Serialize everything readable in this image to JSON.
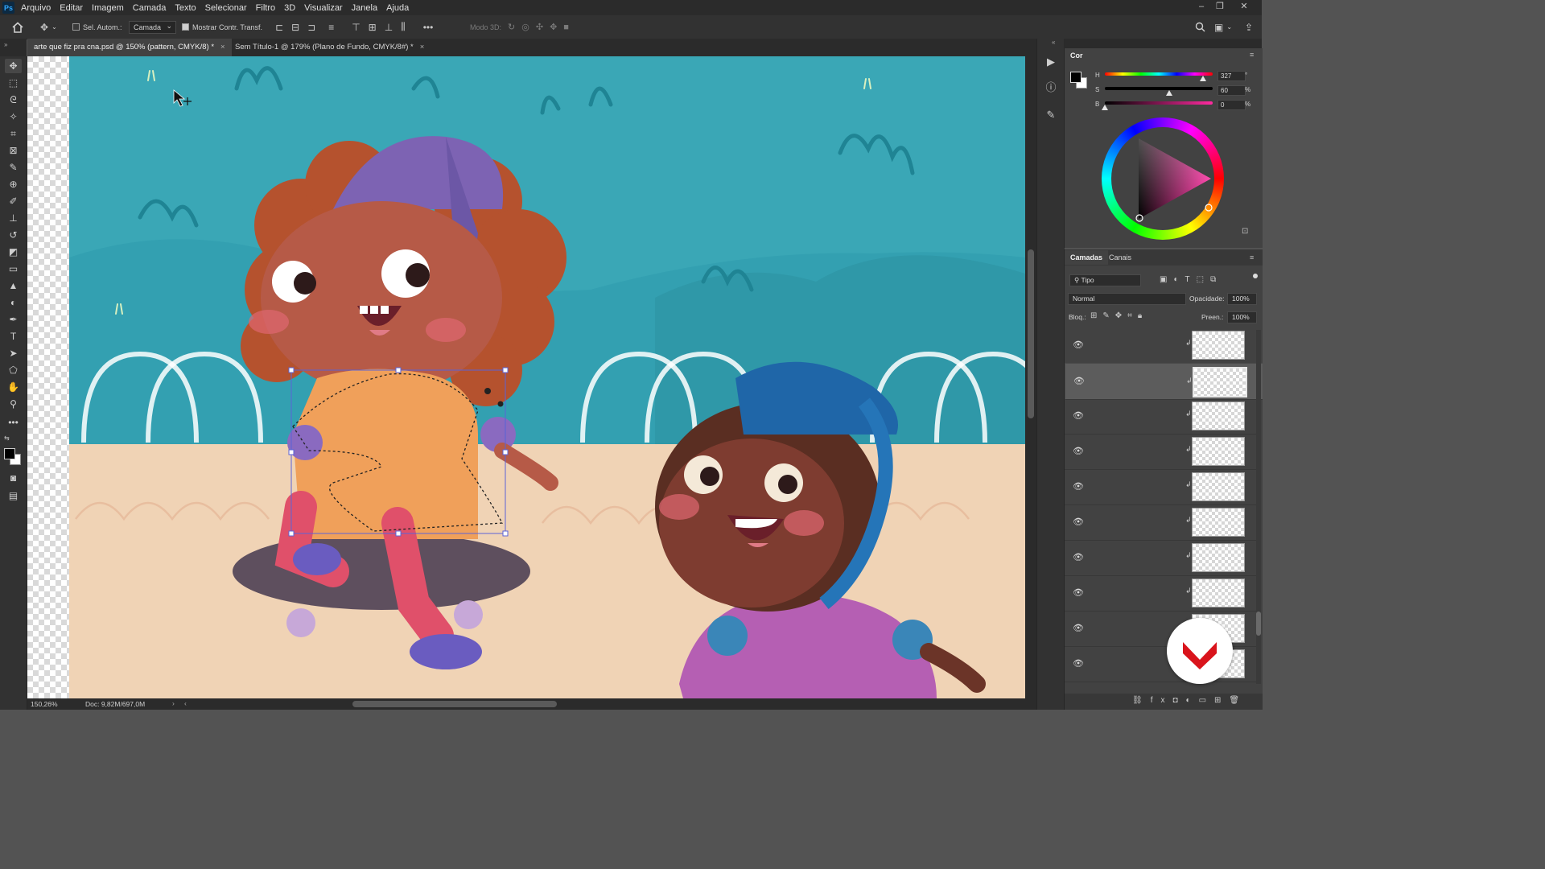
{
  "app": {
    "name": "Photoshop",
    "logo_text": "Ps"
  },
  "menu": [
    "Arquivo",
    "Editar",
    "Imagem",
    "Camada",
    "Texto",
    "Selecionar",
    "Filtro",
    "3D",
    "Visualizar",
    "Janela",
    "Ajuda"
  ],
  "options_bar": {
    "auto_select_label": "Sel. Autom.:",
    "auto_select_target": "Camada",
    "show_transform_label": "Mostrar Contr. Transf.",
    "mode_3d_label": "Modo 3D:"
  },
  "tabs": [
    {
      "label": "arte que fiz pra cna.psd @ 150% (pattern, CMYK/8) *",
      "active": true
    },
    {
      "label": "Sem Título-1 @ 179% (Plano de Fundo, CMYK/8#) *",
      "active": false
    }
  ],
  "status": {
    "zoom": "150,26%",
    "doc": "Doc: 9,82M/697,0M"
  },
  "color_panel": {
    "tab": "Cor",
    "sliders": [
      {
        "label": "H",
        "value": "327",
        "unit": "°",
        "level": 0.91
      },
      {
        "label": "S",
        "value": "60",
        "unit": "%",
        "level": 0.6
      },
      {
        "label": "B",
        "value": "0",
        "unit": "%",
        "level": 0.0
      }
    ],
    "hue_color": "#ff2aa0",
    "fg_color": "#000000",
    "bg_color": "#ffffff"
  },
  "layers_panel": {
    "tabs": [
      "Camadas",
      "Canais"
    ],
    "filter": "Tipo",
    "blend_mode": "Normal",
    "opacity_label": "Opacidade:",
    "opacity": "100%",
    "lock_label": "Bloq.:",
    "fill_label": "Preen.:",
    "fill": "100%",
    "rows": [
      {
        "selected": false
      },
      {
        "selected": true
      },
      {
        "selected": false
      },
      {
        "selected": false
      },
      {
        "selected": false
      },
      {
        "selected": false
      },
      {
        "selected": false
      },
      {
        "selected": false
      },
      {
        "selected": false
      },
      {
        "selected": false
      }
    ]
  },
  "icons": {
    "home": "home-icon",
    "move": "move-icon",
    "search": "search-icon",
    "workspace": "workspace-icon",
    "share": "share-icon"
  }
}
